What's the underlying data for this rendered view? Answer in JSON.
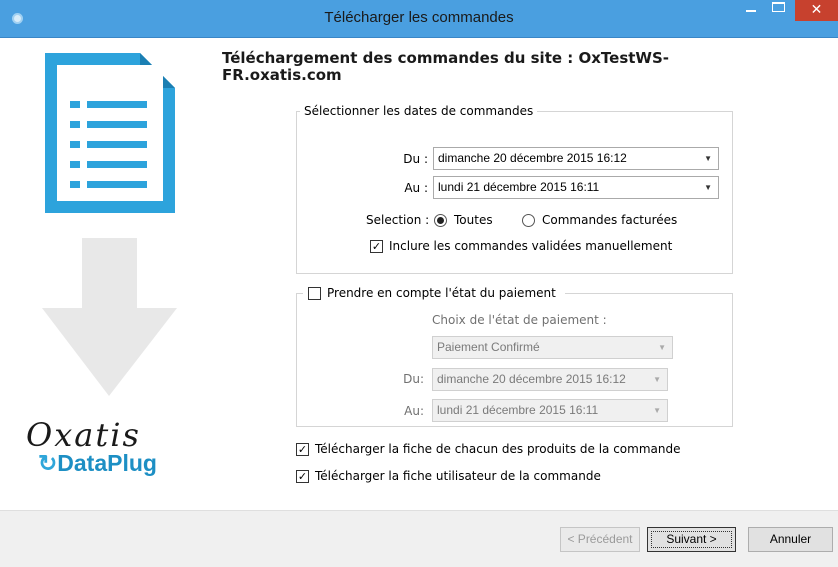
{
  "window": {
    "title": "Télécharger les commandes",
    "close_glyph": "✕"
  },
  "brand": {
    "oxatis": "Oxatis",
    "dataplug_symbol": "↻",
    "dataplug": "DataPlug"
  },
  "heading": "Téléchargement des commandes du site : OxTestWS-FR.oxatis.com",
  "dates_group": {
    "legend": "Sélectionner les dates de commandes",
    "from_label": "Du :",
    "from_value": "dimanche 20 décembre 2015 16:12",
    "to_label": "Au :",
    "to_value": "lundi 21 décembre 2015 16:11",
    "selection_label": "Selection :",
    "radio_all": "Toutes",
    "radio_invoiced": "Commandes facturées",
    "include_manual": "Inclure les commandes validées manuellement"
  },
  "payment_group": {
    "legend": "Prendre en compte l'état du paiement",
    "choice_label": "Choix de l'état de paiement :",
    "status_value": "Paiement Confirmé",
    "from_label": "Du:",
    "from_value": "dimanche 20 décembre 2015 16:12",
    "to_label": "Au:",
    "to_value": "lundi 21 décembre 2015 16:11"
  },
  "options": {
    "download_products": "Télécharger la fiche de chacun des produits de la commande",
    "download_user": "Télécharger la fiche utilisateur de la commande"
  },
  "buttons": {
    "previous": "< Précédent",
    "next": "Suivant >",
    "cancel": "Annuler"
  },
  "glyphs": {
    "check": "✓",
    "dropdown": "▼"
  },
  "colors": {
    "titlebar": "#4a9fe0",
    "close": "#c7412e",
    "doc_icon": "#2da3dc",
    "arrow_icon": "#e8e8e8",
    "dataplug": "#1d8fc4"
  }
}
